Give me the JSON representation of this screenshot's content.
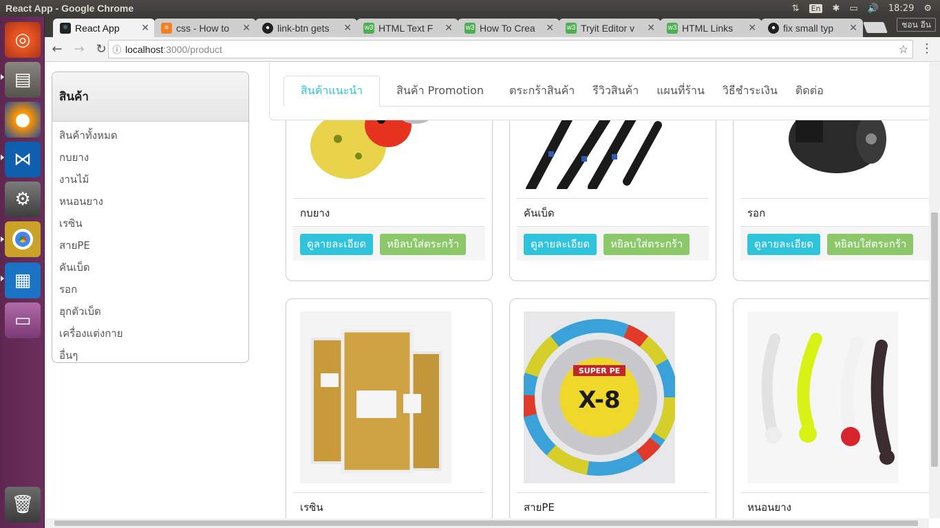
{
  "os_panel": {
    "window_title": "React App - Google Chrome",
    "lang": "En",
    "time": "18:29"
  },
  "launcher": {
    "items": [
      "ubuntu-dash",
      "files",
      "firefox",
      "vscode",
      "system-settings",
      "chrome",
      "writer",
      "workspaces",
      "trash"
    ]
  },
  "browser": {
    "tabs": [
      {
        "label": "React App",
        "favicon": "react-icon",
        "active": true
      },
      {
        "label": "css - How to",
        "favicon": "stackoverflow-icon"
      },
      {
        "label": "link-btn gets",
        "favicon": "github-icon"
      },
      {
        "label": "HTML Text F",
        "favicon": "w3schools-icon"
      },
      {
        "label": "How To Crea",
        "favicon": "w3schools-icon"
      },
      {
        "label": "Tryit Editor v",
        "favicon": "w3schools-icon"
      },
      {
        "label": "HTML Links",
        "favicon": "w3schools-icon"
      },
      {
        "label": "fix small typ",
        "favicon": "github-icon"
      }
    ],
    "profile_label": "ชอน อีน",
    "url_host": "localhost",
    "url_path": ":3000/product"
  },
  "sidebar": {
    "title": "สินค้า",
    "items": [
      "สินค้าทั้งหมด",
      "กบยาง",
      "งานไม้",
      "หนอนยาง",
      "เรซิน",
      "สายPE",
      "คันเบ็ด",
      "รอก",
      "ฮุกตัวเบ็ด",
      "เครื่องแต่งกาย",
      "อื่นๆ"
    ]
  },
  "nav_tabs": [
    {
      "label": "สินค้าแนะนำ",
      "active": true
    },
    {
      "label": "สินค้า Promotion"
    },
    {
      "label": "ตระกร้าสินค้า"
    },
    {
      "label": "รีวิวสินค้า"
    },
    {
      "label": "แผนที่ร้าน"
    },
    {
      "label": "วิธีชำระเงิน"
    },
    {
      "label": "ติดต่อ"
    }
  ],
  "products": [
    {
      "name": "กบยาง",
      "image": "rubber-frog-lure"
    },
    {
      "name": "คันเบ็ด",
      "image": "fishing-rods"
    },
    {
      "name": "รอก",
      "image": "fishing-reel"
    },
    {
      "name": "เรซิน",
      "image": "resin-bags"
    },
    {
      "name": "สายPE",
      "image": "pe-line-spool"
    },
    {
      "name": "หนอนยาง",
      "image": "rubber-worm-lures"
    }
  ],
  "buttons": {
    "details": "ดูลายละเอียด",
    "add_to_cart": "หยิลบใส่ตระกร้า"
  },
  "colors": {
    "info": "#2fc3dc",
    "success": "#8cc86a",
    "launcher": "#5e2750"
  }
}
